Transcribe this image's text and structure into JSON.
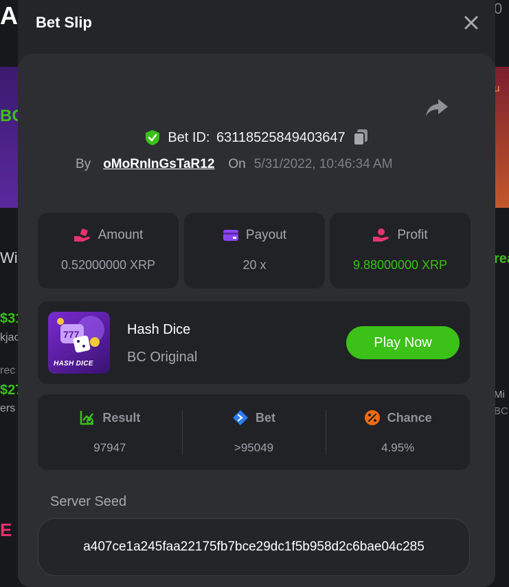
{
  "background": {
    "left_fragments": [
      "AI",
      "BC",
      "Wi",
      "$31",
      "kjac",
      "rec",
      "$27",
      "ers",
      "E"
    ],
    "right_fragments": [
      "0",
      "u",
      "rea",
      "Mi",
      "BC"
    ]
  },
  "modal": {
    "title": "Bet Slip",
    "close_icon": "close-icon",
    "share_icon": "share-icon"
  },
  "bet": {
    "id_label": "Bet ID:",
    "id_value": "63118525849403647",
    "by_label": "By",
    "username": "oMoRnInGsTaR12",
    "on_label": "On",
    "date": "5/31/2022, 10:46:34 AM"
  },
  "stats": [
    {
      "label": "Amount",
      "value": "0.52000000 XRP",
      "icon": "amount-icon",
      "color": "#e8336d"
    },
    {
      "label": "Payout",
      "value": "20 x",
      "icon": "payout-icon",
      "color": "#8b45f0"
    },
    {
      "label": "Profit",
      "value": "9.88000000 XRP",
      "icon": "profit-icon",
      "color": "#e8336d"
    }
  ],
  "game": {
    "name": "Hash Dice",
    "provider": "BC Original",
    "thumb_text": "HASH DICE",
    "play_label": "Play Now"
  },
  "results": [
    {
      "label": "Result",
      "value": "97947",
      "icon": "result-icon",
      "color": "#3bc117"
    },
    {
      "label": "Bet",
      "value": ">95049",
      "icon": "bet-icon",
      "color": "#2a7df5"
    },
    {
      "label": "Chance",
      "value": "4.95%",
      "icon": "chance-icon",
      "color": "#f06a12"
    }
  ],
  "seed": {
    "label": "Server Seed",
    "value": "a407ce1a245faa22175fb7bce29dc1f5b958d2c6bae04c285"
  },
  "colors": {
    "accent_green": "#3bc117",
    "panel": "#2c2e32",
    "card": "#202226"
  }
}
